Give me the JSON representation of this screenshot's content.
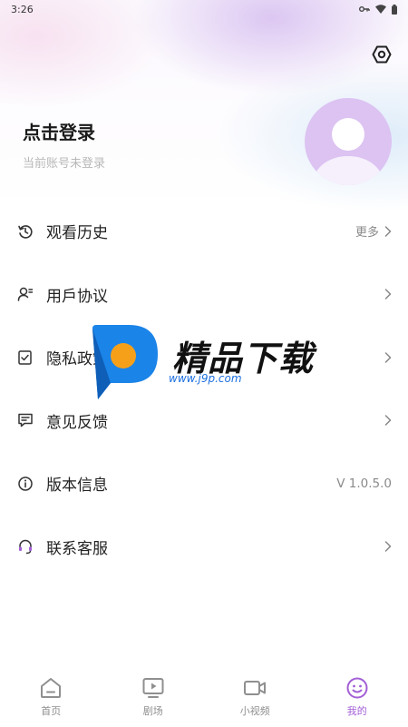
{
  "status_bar": {
    "time": "3:26"
  },
  "profile": {
    "title": "点击登录",
    "subtitle": "当前账号未登录"
  },
  "menu": [
    {
      "label": "观看历史",
      "extra": "更多",
      "icon": "history-icon"
    },
    {
      "label": "用戶协议",
      "extra": "",
      "icon": "user-agreement-icon"
    },
    {
      "label": "隐私政策",
      "extra": "",
      "icon": "privacy-icon"
    },
    {
      "label": "意见反馈",
      "extra": "",
      "icon": "feedback-icon"
    },
    {
      "label": "版本信息",
      "extra": "V 1.0.5.0",
      "icon": "info-icon"
    },
    {
      "label": "联系客服",
      "extra": "",
      "icon": "headset-icon"
    }
  ],
  "watermark": {
    "title": "精品下载",
    "url": "www.j9p.com"
  },
  "tabbar": {
    "tabs": [
      {
        "label": "首页",
        "icon": "home-icon"
      },
      {
        "label": "剧场",
        "icon": "theater-icon"
      },
      {
        "label": "小视频",
        "icon": "video-camera-icon"
      },
      {
        "label": "我的",
        "icon": "smiley-icon"
      }
    ],
    "active_index": 3
  },
  "colors": {
    "accent": "#a35fd6",
    "avatar_bg": "#dcc3f2"
  }
}
